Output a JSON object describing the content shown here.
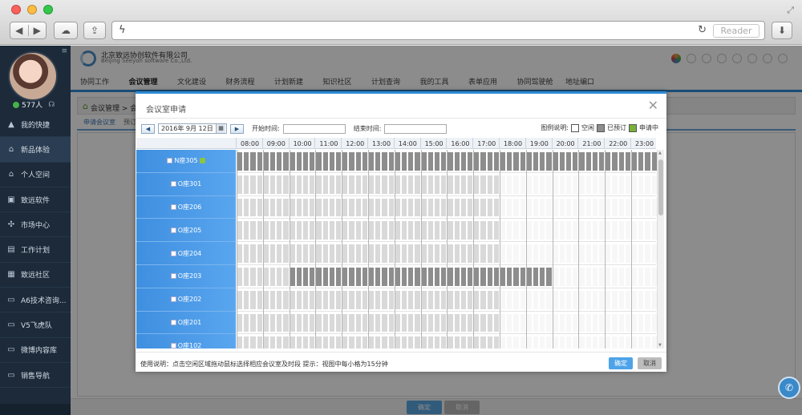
{
  "browser": {
    "reader_label": "Reader",
    "icons": [
      "back-icon",
      "forward-icon",
      "icloud-icon",
      "share-icon",
      "lightning-icon",
      "reload-icon",
      "download-icon",
      "resize-icon"
    ]
  },
  "sidebar": {
    "online_count": "577人",
    "items": [
      {
        "label": "我的快捷",
        "icon": "▲"
      },
      {
        "label": "新品体验",
        "icon": "⌂",
        "active": true
      },
      {
        "label": "个人空间",
        "icon": "⌂"
      },
      {
        "label": "致远软件",
        "icon": "▣"
      },
      {
        "label": "市场中心",
        "icon": "✣"
      },
      {
        "label": "工作计划",
        "icon": "▤"
      },
      {
        "label": "致远社区",
        "icon": "▦"
      },
      {
        "label": "A6技术咨询...",
        "icon": "▭"
      },
      {
        "label": "V5飞虎队",
        "icon": "▭"
      },
      {
        "label": "微博内容库",
        "icon": "▭"
      },
      {
        "label": "销售导航",
        "icon": "▭"
      }
    ]
  },
  "header": {
    "brand_cn": "北京致远协创软件有限公司",
    "brand_en": "Beijing Seeyon software Co.,Ltd.",
    "nav": [
      "协同工作",
      "会议管理",
      "文化建设",
      "财务流程",
      "计划新建",
      "知识社区",
      "计划查询",
      "我的工具",
      "表单应用",
      "协同驾驶舱",
      "地址编口"
    ],
    "active_nav": "会议管理",
    "breadcrumb": "会议管理 > 会",
    "subtabs": [
      "申请会议室",
      "预订"
    ]
  },
  "page_buttons": {
    "ok": "确定",
    "cancel": "取消"
  },
  "dialog": {
    "title": "会议室申请",
    "date": "2016年 9月 12日",
    "start_label": "开始时间:",
    "end_label": "结束时间:",
    "legend_label": "图例说明:",
    "legend": [
      {
        "label": "空闲",
        "color": "#ffffff"
      },
      {
        "label": "已预订",
        "color": "#8d8d8d"
      },
      {
        "label": "申请中",
        "color": "#79b23a"
      }
    ],
    "hours": [
      "08:00",
      "09:00",
      "10:00",
      "11:00",
      "12:00",
      "13:00",
      "14:00",
      "15:00",
      "16:00",
      "17:00",
      "18:00",
      "19:00",
      "20:00",
      "21:00",
      "22:00",
      "23:00"
    ],
    "rooms": [
      {
        "name": "N座305",
        "marker": true
      },
      {
        "name": "O座301"
      },
      {
        "name": "O座206"
      },
      {
        "name": "O座205"
      },
      {
        "name": "O座204"
      },
      {
        "name": "O座203"
      },
      {
        "name": "O座202"
      },
      {
        "name": "O座201"
      },
      {
        "name": "O座102"
      }
    ],
    "usage_text": "使用说明：点击空闲区域拖动鼠标选择相应会议室及时段 提示：视图中每小格为15分钟",
    "ok_label": "确定",
    "cancel_label": "取消"
  }
}
